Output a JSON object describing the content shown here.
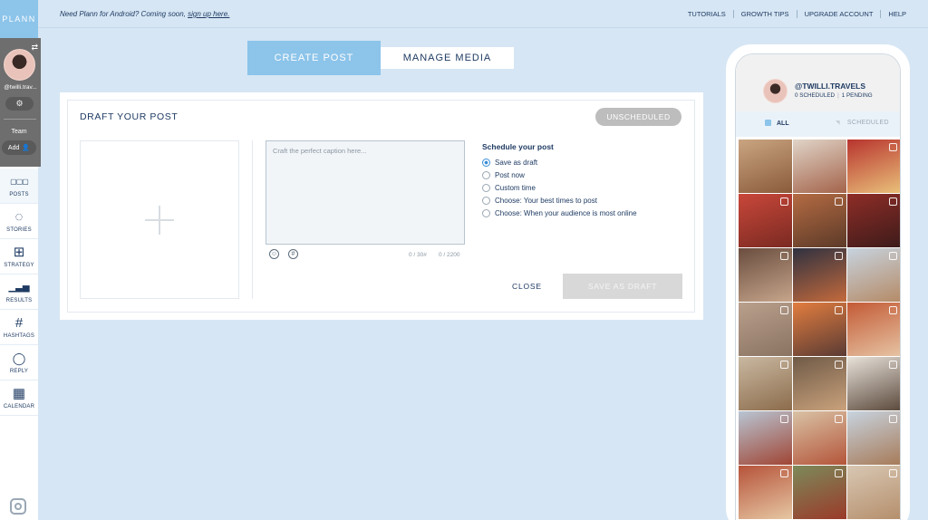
{
  "brand": "PLANN",
  "account": {
    "handle": "@twilli.trav...",
    "team_label": "Team",
    "add_label": "Add"
  },
  "nav": [
    {
      "label": "POSTS",
      "icon": "grid-icon",
      "glyph": "▢▢▢"
    },
    {
      "label": "STORIES",
      "icon": "stories-circle-icon",
      "glyph": "◌"
    },
    {
      "label": "STRATEGY",
      "icon": "strategy-grid-icon",
      "glyph": "⊞"
    },
    {
      "label": "RESULTS",
      "icon": "bar-chart-icon",
      "glyph": "▁▃▅"
    },
    {
      "label": "HASHTAGS",
      "icon": "hashtag-icon",
      "glyph": "#"
    },
    {
      "label": "REPLY",
      "icon": "chat-bubble-icon",
      "glyph": "◯"
    },
    {
      "label": "CALENDAR",
      "icon": "calendar-icon",
      "glyph": "▦"
    }
  ],
  "topbar": {
    "promo_text": "Need Plann for Android? Coming soon, ",
    "promo_link": "sign up here.",
    "links": [
      "TUTORIALS",
      "GROWTH TIPS",
      "UPGRADE ACCOUNT",
      "HELP"
    ]
  },
  "tabs": {
    "create": "CREATE POST",
    "manage": "MANAGE MEDIA"
  },
  "draft": {
    "title": "DRAFT YOUR POST",
    "status": "UNSCHEDULED",
    "caption_placeholder": "Craft the perfect caption here...",
    "hashtag_count": "0 / 30#",
    "char_count": "0 / 2200",
    "schedule_title": "Schedule your post",
    "options": [
      {
        "label": "Save as draft",
        "selected": true
      },
      {
        "label": "Post now",
        "selected": false
      },
      {
        "label": "Custom time",
        "selected": false
      },
      {
        "label": "Choose: Your best times to post",
        "selected": false
      },
      {
        "label": "Choose: When your audience is most online",
        "selected": false
      }
    ],
    "close_label": "CLOSE",
    "save_label": "SAVE AS DRAFT"
  },
  "preview": {
    "handle": "@TWILLI.TRAVELS",
    "scheduled": "0 SCHEDULED",
    "pending": "1 PENDING",
    "tab_all": "ALL",
    "tab_scheduled": "SCHEDULED"
  },
  "colors": {
    "accent": "#8cc4ea",
    "background": "#d6e6f4",
    "navy": "#1f3b63",
    "disabled": "#d8d8d8"
  },
  "grid_tiles": [
    {
      "colors": [
        "#caa582",
        "#8a5b3b"
      ],
      "ig": false
    },
    {
      "colors": [
        "#e0d4c8",
        "#a4634a"
      ],
      "ig": false
    },
    {
      "colors": [
        "#b8342e",
        "#e9c07a"
      ],
      "ig": true
    },
    {
      "colors": [
        "#c9473a",
        "#7a2a22"
      ],
      "ig": true
    },
    {
      "colors": [
        "#b46b43",
        "#5c3a28"
      ],
      "ig": true
    },
    {
      "colors": [
        "#8f2d27",
        "#3d1b1a"
      ],
      "ig": true
    },
    {
      "colors": [
        "#6a4d3f",
        "#c6a58b"
      ],
      "ig": true
    },
    {
      "colors": [
        "#2f3140",
        "#c46a3c"
      ],
      "ig": true
    },
    {
      "colors": [
        "#c7d3df",
        "#b58b67"
      ],
      "ig": true
    },
    {
      "colors": [
        "#b9a08d",
        "#8a7361"
      ],
      "ig": true
    },
    {
      "colors": [
        "#e27d3f",
        "#5a3b34"
      ],
      "ig": true
    },
    {
      "colors": [
        "#c35a35",
        "#e6c3a3"
      ],
      "ig": true
    },
    {
      "colors": [
        "#c9b8a1",
        "#8c6c4c"
      ],
      "ig": true
    },
    {
      "colors": [
        "#6f5a47",
        "#caa27c"
      ],
      "ig": true
    },
    {
      "colors": [
        "#e8e2da",
        "#5c4a3d"
      ],
      "ig": true
    },
    {
      "colors": [
        "#b8c5d3",
        "#a04534"
      ],
      "ig": true
    },
    {
      "colors": [
        "#d9c2a5",
        "#b4553a"
      ],
      "ig": true
    },
    {
      "colors": [
        "#c7d3df",
        "#a77b59"
      ],
      "ig": true
    },
    {
      "colors": [
        "#b6533a",
        "#e6c7a3"
      ],
      "ig": true
    },
    {
      "colors": [
        "#7c8a5a",
        "#9a3a2a"
      ],
      "ig": true
    },
    {
      "colors": [
        "#d8c7b3",
        "#b58f6c"
      ],
      "ig": true
    }
  ]
}
